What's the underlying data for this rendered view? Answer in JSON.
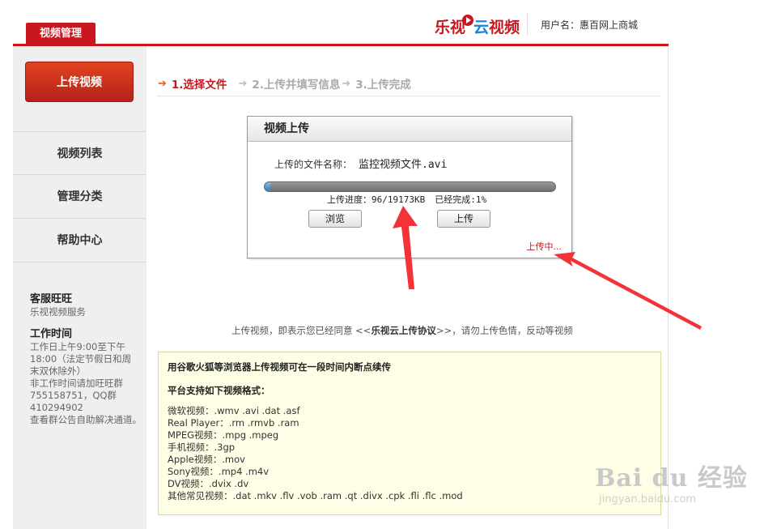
{
  "header": {
    "tab_label": "视频管理",
    "logo_text_1": "乐视",
    "logo_text_2": "云",
    "logo_text_3": "视频",
    "user_label": "用户名：惠百网上商城"
  },
  "sidebar": {
    "upload_button": "上传视频",
    "items": [
      {
        "label": "视频列表"
      },
      {
        "label": "管理分类"
      },
      {
        "label": "帮助中心"
      }
    ],
    "service_title": "客服旺旺",
    "service_text": "乐视视频服务",
    "hours_title": "工作时间",
    "hours_lines": [
      "工作日上午9:00至下午",
      "18:00（法定节假日和周",
      "末双休除外）",
      "非工作时间请加旺旺群",
      "755158751，QQ群",
      "410294902",
      "查看群公告自助解决通道。"
    ]
  },
  "steps": {
    "step1": "1.选择文件",
    "step2": "2.上传并填写信息",
    "step3": "3.上传完成"
  },
  "dialog": {
    "title": "视频上传",
    "file_label": "上传的文件名称：",
    "file_name": "监控视频文件.avi",
    "progress_fraction": 0.01,
    "progress_label": "上传进度：96/19173KB",
    "completed_label": "已经完成:1%",
    "browse_button": "浏览",
    "upload_button": "上传",
    "status": "上传中..."
  },
  "agreement": {
    "prefix": "上传视频，即表示您已经同意 <<",
    "link": "乐视云上传协议",
    "suffix": ">>，请勿上传色情，反动等视频"
  },
  "info": {
    "resume_note": "用谷歌火狐等浏览器上传视频可在一段时间内断点续传",
    "formats_title": "平台支持如下视频格式：",
    "formats": [
      "微软视频：.wmv .avi .dat .asf",
      "Real Player：.rm .rmvb .ram",
      "MPEG视频：.mpg .mpeg",
      "手机视频：.3gp",
      "Apple视频：.mov",
      "Sony视频：.mp4 .m4v",
      "DV视频：.dvix .dv",
      "其他常见视频：.dat .mkv .flv .vob .ram .qt .divx .cpk .fli .flc .mod"
    ]
  },
  "watermark": {
    "main": "Bai du 经验",
    "sub": "jingyan.baidu.com"
  },
  "colors": {
    "brand_red": "#c8171e",
    "progress_blue": "#2b7fd1",
    "info_bg": "#fefee6"
  }
}
